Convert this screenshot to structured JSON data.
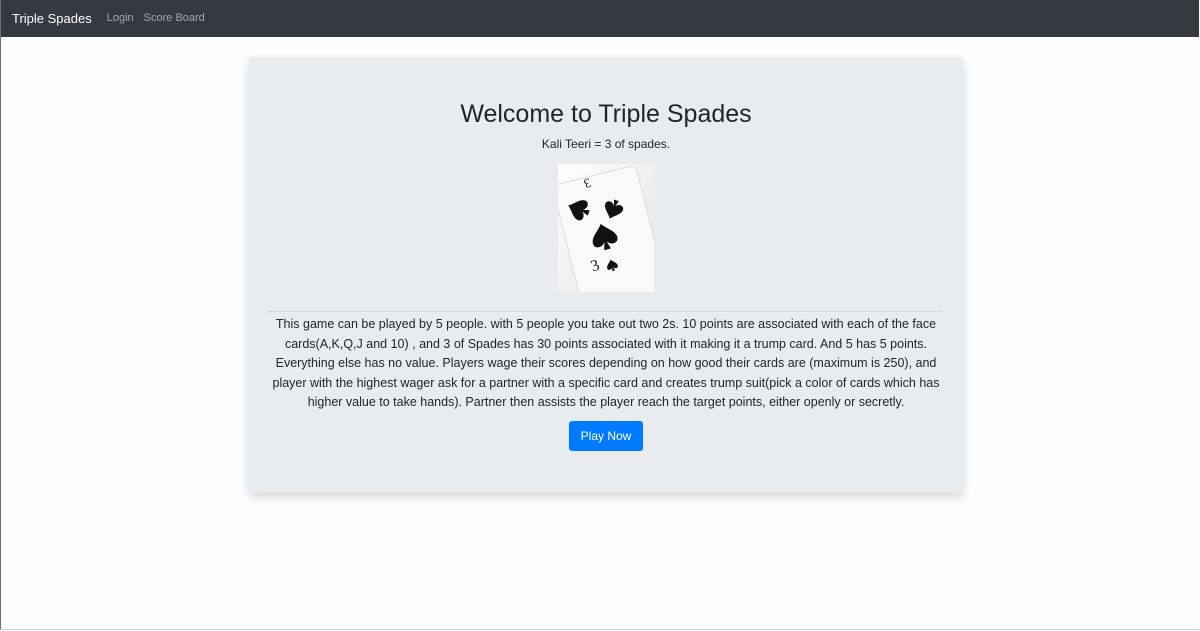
{
  "navbar": {
    "brand": "Triple Spades",
    "links": [
      {
        "label": "Login"
      },
      {
        "label": "Score Board"
      }
    ]
  },
  "jumbotron": {
    "title": "Welcome to Triple Spades",
    "subtitle": "Kali Teeri = 3 of spades.",
    "image_icon": "three-of-spades-card",
    "image_rank": "3",
    "description": "This game can be played by 5 people. with 5 people you take out two 2s. 10 points are associated with each of the face cards(A,K,Q,J and 10) , and 3 of Spades has 30 points associated with it making it a trump card. And 5 has 5 points. Everything else has no value. Players wage their scores depending on how good their cards are (maximum is 250), and player with the highest wager ask for a partner with a specific card and creates trump suit(pick a color of cards which has higher value to take hands). Partner then assists the player reach the target points, either openly or secretly.",
    "play_button": "Play Now"
  },
  "colors": {
    "navbar": "#343a40",
    "jumbotron": "#e9ecef",
    "primary": "#007bff"
  }
}
